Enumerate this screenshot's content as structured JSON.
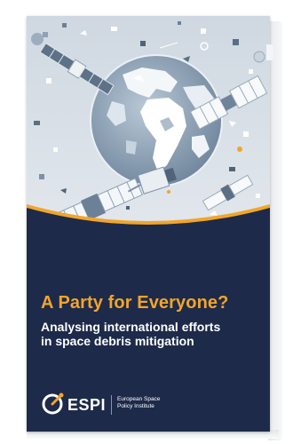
{
  "cover": {
    "title": "A Party for Everyone?",
    "subtitle_line1": "Analysing international efforts",
    "subtitle_line2": "in space debris mitigation",
    "logo_name": "ESPI",
    "logo_sub_line1": "European Space",
    "logo_sub_line2": "Policy Institute"
  },
  "colors": {
    "navy": "#1d2a4a",
    "accent": "#f2a52a",
    "art_bg": "#d6dee6"
  },
  "icons": [
    "earth-illustration",
    "satellite-illustration",
    "debris-illustration",
    "espi-logo-mark"
  ]
}
